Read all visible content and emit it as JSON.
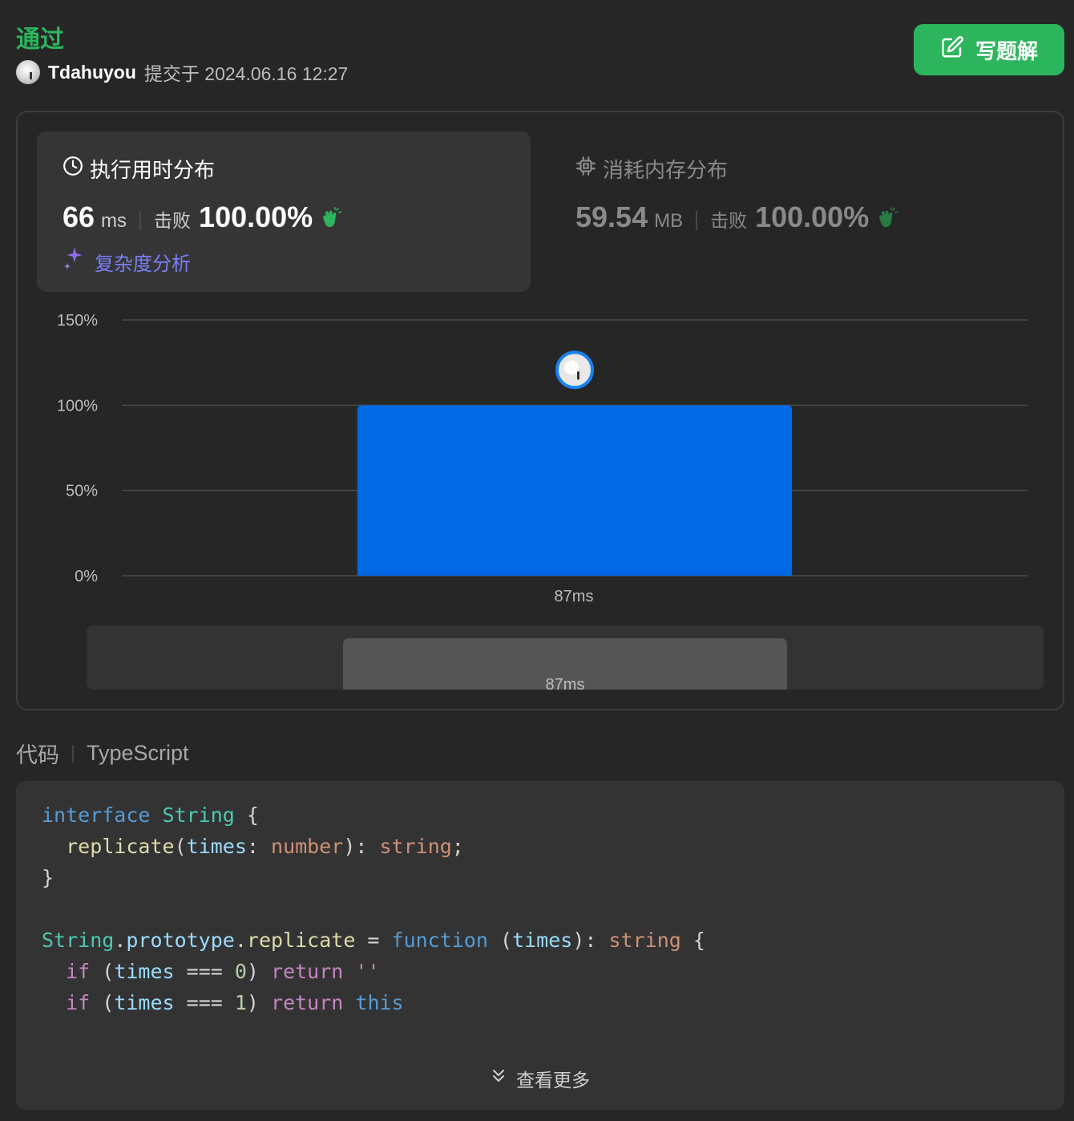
{
  "header": {
    "status": "通过",
    "username": "Tdahuyou",
    "submitted_text": "提交于 2024.06.16 12:27",
    "write_solution": "写题解"
  },
  "runtime": {
    "title": "执行用时分布",
    "value": "66",
    "unit": "ms",
    "beat_label": "击败",
    "beat_pct": "100.00%",
    "complexity_link": "复杂度分析"
  },
  "memory": {
    "title": "消耗内存分布",
    "value": "59.54",
    "unit": "MB",
    "beat_label": "击败",
    "beat_pct": "100.00%"
  },
  "chart_data": {
    "type": "bar",
    "categories": [
      "87ms"
    ],
    "values": [
      100
    ],
    "yticks": [
      "0%",
      "50%",
      "100%",
      "150%"
    ],
    "ylim": [
      0,
      150
    ],
    "grid": true,
    "bar_color": "#0069e3",
    "navigator_label": "87ms"
  },
  "code": {
    "label": "代码",
    "language": "TypeScript",
    "see_more": "查看更多"
  },
  "colors": {
    "accent_green": "#2db55d",
    "bar_blue": "#0069e3",
    "complexity_purple": "#7b7ff5"
  }
}
